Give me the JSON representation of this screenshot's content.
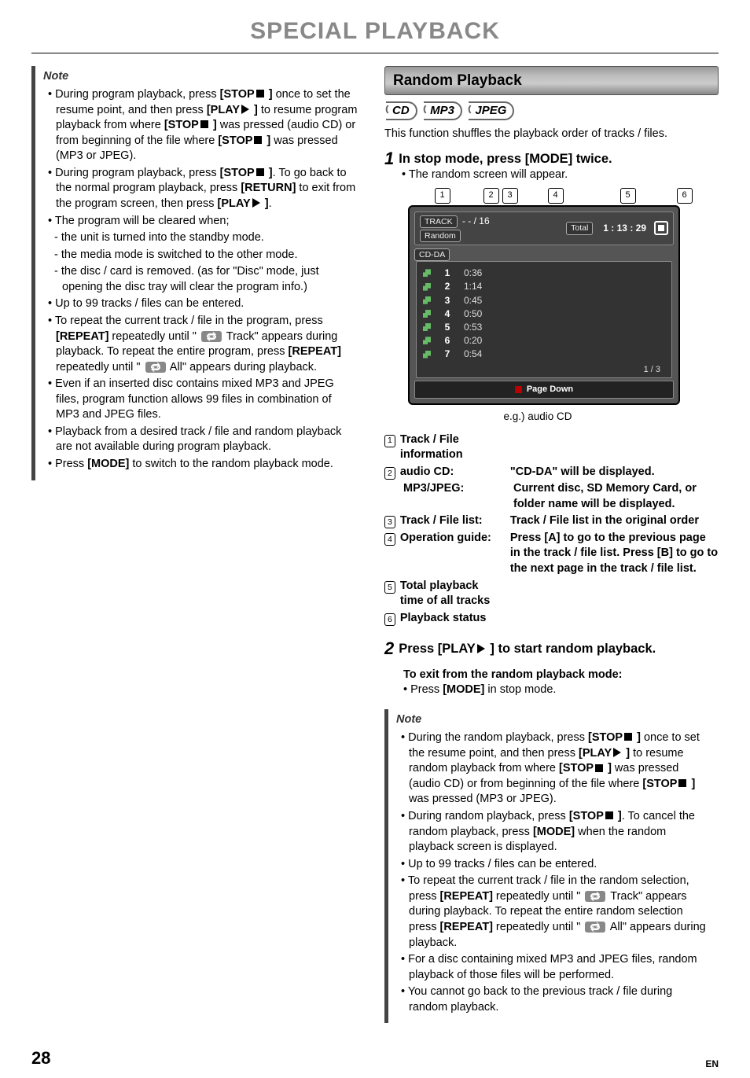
{
  "header": {
    "title": "SPECIAL PLAYBACK"
  },
  "noteA": {
    "title": "Note",
    "items": [
      {
        "type": "li",
        "segments": [
          [
            "txt",
            "During program playback, press "
          ],
          [
            "key",
            "[STOP"
          ],
          [
            "stop",
            ""
          ],
          [
            "key",
            " ]"
          ],
          [
            "txt",
            " once to set the resume point, and then press "
          ],
          [
            "key",
            "[PLAY"
          ],
          [
            "play",
            ""
          ],
          [
            "key",
            " ]"
          ],
          [
            "txt",
            " to resume program playback from where "
          ],
          [
            "key",
            "[STOP"
          ],
          [
            "stop",
            ""
          ],
          [
            "key",
            " ]"
          ],
          [
            "txt",
            " was pressed (audio CD) or from beginning of the file where "
          ],
          [
            "key",
            "[STOP"
          ],
          [
            "stop",
            ""
          ],
          [
            "key",
            " ]"
          ],
          [
            "txt",
            " was pressed (MP3 or JPEG)."
          ]
        ]
      },
      {
        "type": "li",
        "segments": [
          [
            "txt",
            "During program playback, press "
          ],
          [
            "key",
            "[STOP"
          ],
          [
            "stop",
            ""
          ],
          [
            "key",
            " ]"
          ],
          [
            "txt",
            ". To go back to the normal program playback, press "
          ],
          [
            "key",
            "[RETURN]"
          ],
          [
            "txt",
            " to exit from the program screen, then press "
          ],
          [
            "key",
            "[PLAY"
          ],
          [
            "play",
            ""
          ],
          [
            "key",
            " ]"
          ],
          [
            "txt",
            "."
          ]
        ]
      },
      {
        "type": "li",
        "segments": [
          [
            "txt",
            "The program will be cleared when;"
          ]
        ]
      },
      {
        "type": "sub",
        "segments": [
          [
            "txt",
            "the unit is turned into the standby mode."
          ]
        ]
      },
      {
        "type": "sub",
        "segments": [
          [
            "txt",
            "the media mode is switched to the other mode."
          ]
        ]
      },
      {
        "type": "sub",
        "segments": [
          [
            "txt",
            "the disc / card is removed. (as for \"Disc\" mode, just opening the disc tray will clear the program info.)"
          ]
        ]
      },
      {
        "type": "li",
        "segments": [
          [
            "txt",
            "Up to 99 tracks / files can be entered."
          ]
        ]
      },
      {
        "type": "li",
        "segments": [
          [
            "txt",
            "To repeat the current track / file in the program, press "
          ],
          [
            "key",
            "[REPEAT]"
          ],
          [
            "txt",
            " repeatedly until \" "
          ],
          [
            "repeat",
            ""
          ],
          [
            "txt",
            " Track\" appears during playback. To repeat the entire program, press "
          ],
          [
            "key",
            "[REPEAT]"
          ],
          [
            "txt",
            " repeatedly until \" "
          ],
          [
            "repeat",
            ""
          ],
          [
            "txt",
            " All\" appears during playback."
          ]
        ]
      },
      {
        "type": "li",
        "segments": [
          [
            "txt",
            "Even if an inserted disc contains mixed MP3 and JPEG files, program function allows 99 files in combination of MP3 and JPEG files."
          ]
        ]
      },
      {
        "type": "li",
        "segments": [
          [
            "txt",
            "Playback from a desired track / file and random playback are not available during program playback."
          ]
        ]
      },
      {
        "type": "li",
        "segments": [
          [
            "txt",
            "Press "
          ],
          [
            "key",
            "[MODE]"
          ],
          [
            "txt",
            " to switch to the random playback mode."
          ]
        ]
      }
    ]
  },
  "right": {
    "section_title": "Random Playback",
    "chips": [
      "CD",
      "MP3",
      "JPEG"
    ],
    "intro": "This function shuffles the playback order of tracks / files.",
    "step1_num": "1",
    "step1_text": "In stop mode, press [MODE] twice.",
    "step1_bullet": "The random screen will appear.",
    "callouts": [
      "1",
      "2",
      "3",
      "4",
      "5",
      "6"
    ],
    "screen": {
      "track_label": "TRACK",
      "track_value": "- - / 16",
      "mode": "Random",
      "disc_type": "CD-DA",
      "total_label": "Total",
      "total_value": "1 : 13 : 29",
      "tracks": [
        {
          "n": "1",
          "t": "0:36"
        },
        {
          "n": "2",
          "t": "1:14"
        },
        {
          "n": "3",
          "t": "0:45"
        },
        {
          "n": "4",
          "t": "0:50"
        },
        {
          "n": "5",
          "t": "0:53"
        },
        {
          "n": "6",
          "t": "0:20"
        },
        {
          "n": "7",
          "t": "0:54"
        }
      ],
      "pager": "1   /   3",
      "pagedown": "Page Down"
    },
    "caption": "e.g.) audio CD",
    "legend": [
      {
        "n": "1",
        "k": "Track / File information",
        "v": ""
      },
      {
        "n": "2",
        "k": "audio CD:",
        "v": "\"CD-DA\" will be displayed."
      },
      {
        "n": "",
        "k": "MP3/JPEG:",
        "v": "Current disc, SD Memory Card, or folder name will be displayed."
      },
      {
        "n": "3",
        "k": "Track / File list:",
        "v": "Track / File list in the original order"
      },
      {
        "n": "4",
        "k": "Operation guide:",
        "v": "Press [A] to go to the previous page in the track / file list. Press [B] to go to the next page in the track / file list."
      },
      {
        "n": "5",
        "k": "Total playback time of all tracks",
        "v": ""
      },
      {
        "n": "6",
        "k": "Playback status",
        "v": ""
      }
    ],
    "step2_num": "2",
    "step2_text_segments": [
      [
        "txt",
        "Press [PLAY"
      ],
      [
        "play",
        ""
      ],
      [
        "txt",
        " ] to start random playback."
      ]
    ],
    "exit_head": "To exit from the random playback mode:",
    "exit_bullet_segments": [
      [
        "txt",
        "Press "
      ],
      [
        "key",
        "[MODE]"
      ],
      [
        "txt",
        " in stop mode."
      ]
    ]
  },
  "noteB": {
    "title": "Note",
    "items": [
      {
        "type": "li",
        "segments": [
          [
            "txt",
            "During the random playback, press "
          ],
          [
            "key",
            "[STOP"
          ],
          [
            "stop",
            ""
          ],
          [
            "key",
            " ]"
          ],
          [
            "txt",
            " once to set the resume point, and then press "
          ],
          [
            "key",
            "[PLAY"
          ],
          [
            "play",
            ""
          ],
          [
            "key",
            " ]"
          ],
          [
            "txt",
            " to resume random playback from where "
          ],
          [
            "key",
            "[STOP"
          ],
          [
            "stop",
            ""
          ],
          [
            "key",
            " ]"
          ],
          [
            "txt",
            " was pressed (audio CD) or from beginning of the file where "
          ],
          [
            "key",
            "[STOP"
          ],
          [
            "stop",
            ""
          ],
          [
            "key",
            " ]"
          ],
          [
            "txt",
            " was pressed (MP3 or JPEG)."
          ]
        ]
      },
      {
        "type": "li",
        "segments": [
          [
            "txt",
            "During random playback, press "
          ],
          [
            "key",
            "[STOP"
          ],
          [
            "stop",
            ""
          ],
          [
            "key",
            " ]"
          ],
          [
            "txt",
            ". To cancel the random playback, press "
          ],
          [
            "key",
            "[MODE]"
          ],
          [
            "txt",
            " when the random playback screen is displayed."
          ]
        ]
      },
      {
        "type": "li",
        "segments": [
          [
            "txt",
            "Up to 99 tracks / files can be entered."
          ]
        ]
      },
      {
        "type": "li",
        "segments": [
          [
            "txt",
            "To repeat the current track / file in the random selection, press "
          ],
          [
            "key",
            "[REPEAT]"
          ],
          [
            "txt",
            " repeatedly until \" "
          ],
          [
            "repeat",
            ""
          ],
          [
            "txt",
            " Track\" appears during playback. To repeat the entire random selection press "
          ],
          [
            "key",
            "[REPEAT]"
          ],
          [
            "txt",
            " repeatedly until \" "
          ],
          [
            "repeat",
            ""
          ],
          [
            "txt",
            " All\" appears during playback."
          ]
        ]
      },
      {
        "type": "li",
        "segments": [
          [
            "txt",
            "For a disc containing mixed MP3 and JPEG files, random playback of those files will be performed."
          ]
        ]
      },
      {
        "type": "li",
        "segments": [
          [
            "txt",
            "You cannot go back to the previous track / file during random playback."
          ]
        ]
      }
    ]
  },
  "footer": {
    "page": "28",
    "lang": "EN"
  }
}
